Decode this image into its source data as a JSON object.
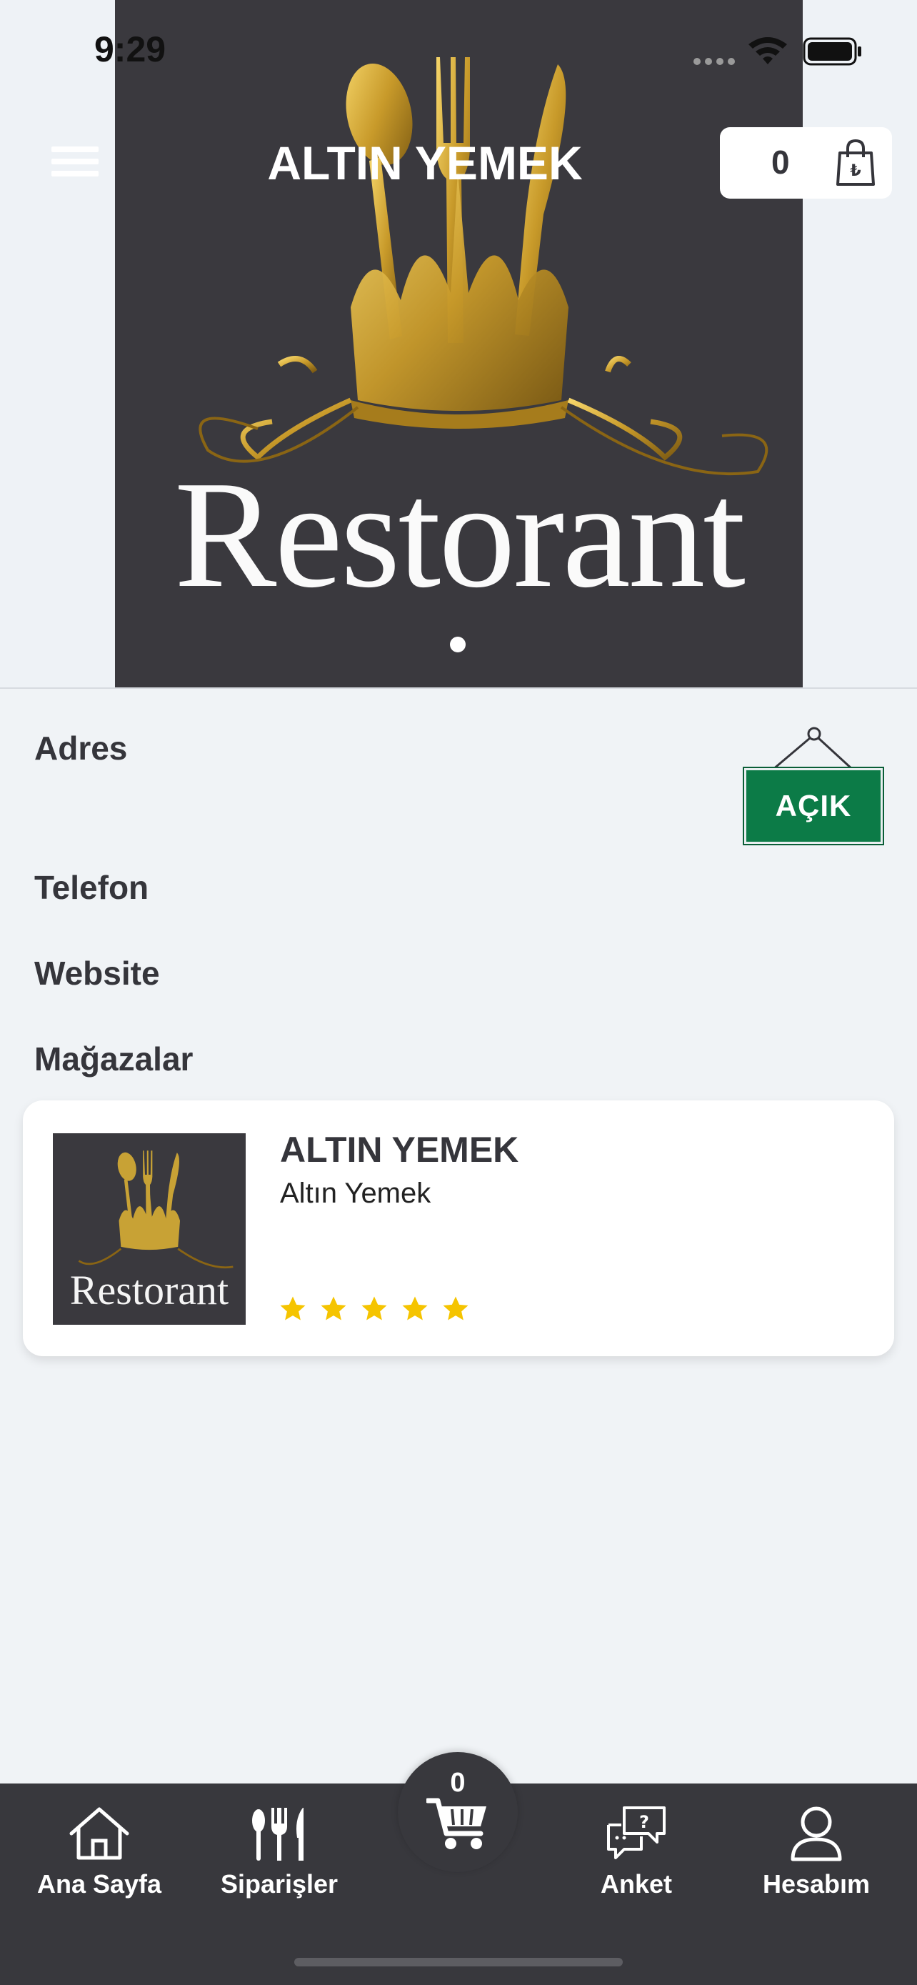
{
  "status_bar": {
    "time": "9:29"
  },
  "header": {
    "title": "ALTIN YEMEK",
    "cart_count": "0"
  },
  "hero": {
    "image_text": "Restorant"
  },
  "info": {
    "address_label": "Adres",
    "phone_label": "Telefon",
    "website_label": "Website",
    "stores_label": "Mağazalar",
    "status_sign": "AÇIK"
  },
  "store": {
    "name": "ALTIN YEMEK",
    "subtitle": "Altın Yemek",
    "thumb_text": "Restorant",
    "rating": 5,
    "rating_max": 5
  },
  "bottom_nav": {
    "items": [
      {
        "label": "Ana Sayfa",
        "icon": "home-icon"
      },
      {
        "label": "Siparişler",
        "icon": "cutlery-icon"
      },
      {
        "label": "Anket",
        "icon": "survey-chat-icon"
      },
      {
        "label": "Hesabım",
        "icon": "user-icon"
      }
    ],
    "cart_count": "0"
  },
  "colors": {
    "dark": "#38383d",
    "background": "#f0f3f6",
    "open_green": "#0c7b47",
    "star": "#f5c400",
    "gold": "#c8a235"
  }
}
